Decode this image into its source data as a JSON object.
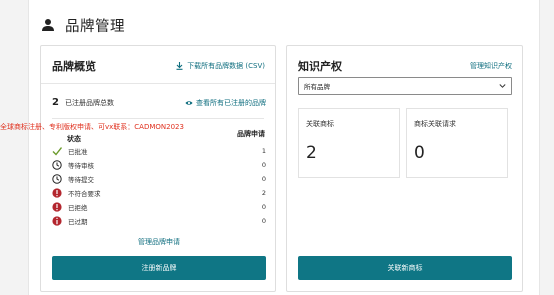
{
  "page": {
    "title": "品牌管理",
    "icon": "person-icon"
  },
  "overview": {
    "title": "品牌概览",
    "download_label": "下载所有品牌数据 (CSV)",
    "total_count": "2",
    "total_label": "已注册品牌总数",
    "view_all_label": "查看所有已注册的品牌",
    "watermark": "全球商标注册、专利版权申请、可vx联系：CADMON2023",
    "col_status": "状态",
    "col_applications": "品牌申请",
    "statuses": [
      {
        "label": "已批准",
        "count": "1",
        "icon": "check-icon",
        "color": "#6a9a2a"
      },
      {
        "label": "等待审核",
        "count": "0",
        "icon": "clock-icon",
        "color": "#222222"
      },
      {
        "label": "等待提交",
        "count": "0",
        "icon": "clock-icon",
        "color": "#222222"
      },
      {
        "label": "不符合要求",
        "count": "2",
        "icon": "alert-icon",
        "color": "#b3262e"
      },
      {
        "label": "已拒绝",
        "count": "0",
        "icon": "alert-icon",
        "color": "#b3262e"
      },
      {
        "label": "已过期",
        "count": "0",
        "icon": "info-icon",
        "color": "#b3262e"
      }
    ],
    "manage_applications_label": "管理品牌申请",
    "register_button": "注册新品牌"
  },
  "ip": {
    "title": "知识产权",
    "manage_label": "管理知识产权",
    "select_value": "所有品牌",
    "metrics": [
      {
        "label": "关联商标",
        "value": "2"
      },
      {
        "label": "商标关联请求",
        "value": "0"
      }
    ],
    "link_button": "关联新商标"
  },
  "colors": {
    "accent": "#0f7685",
    "link": "#0f6e7f",
    "error": "#b3262e",
    "success": "#6a9a2a"
  }
}
